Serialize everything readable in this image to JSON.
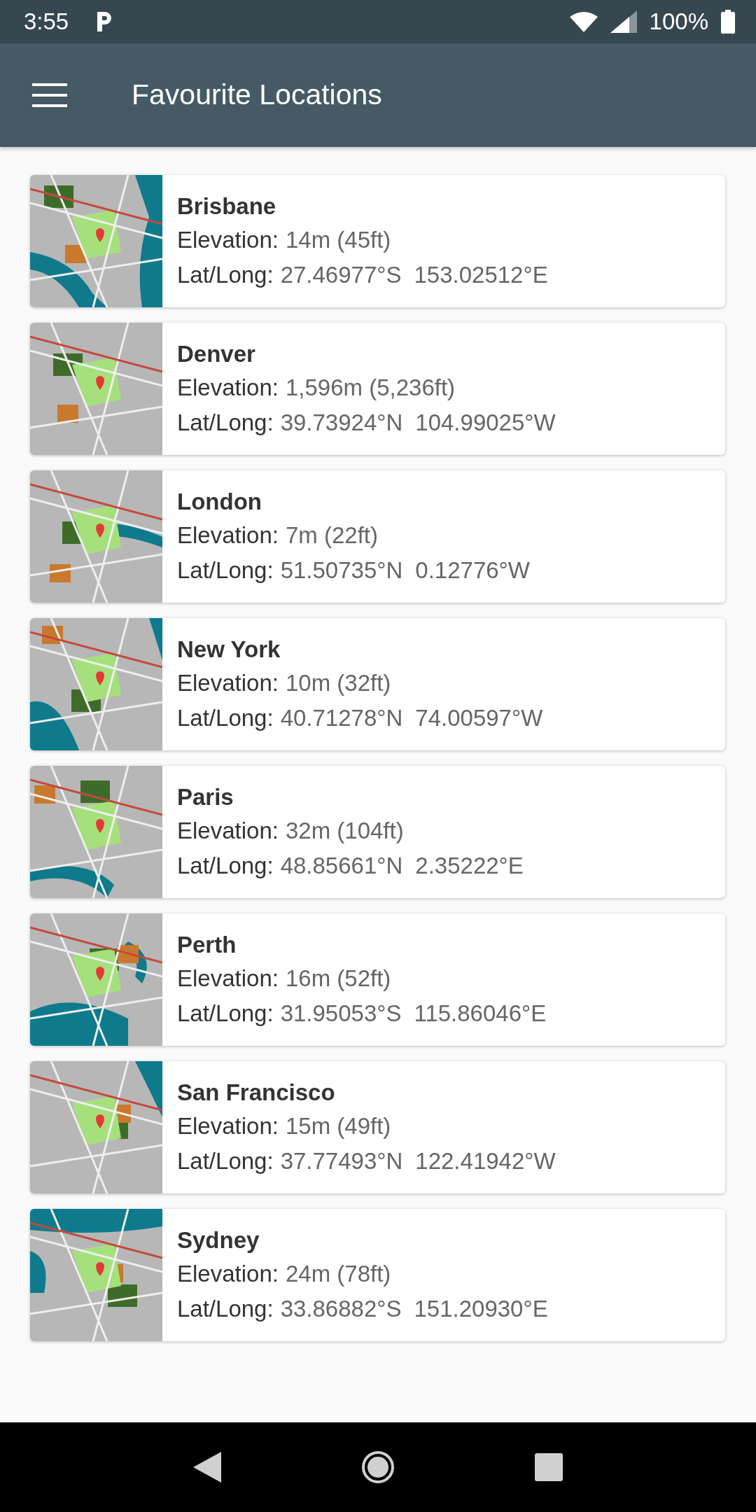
{
  "status_bar": {
    "time": "3:55",
    "battery": "100%"
  },
  "app_bar": {
    "title": "Favourite Locations"
  },
  "locations": [
    {
      "name": "Brisbane",
      "elevation_label": "Elevation:",
      "elevation": "14m (45ft)",
      "latlong_label": "Lat/Long:",
      "lat": "27.46977°S",
      "long": "153.02512°E"
    },
    {
      "name": "Denver",
      "elevation_label": "Elevation:",
      "elevation": "1,596m (5,236ft)",
      "latlong_label": "Lat/Long:",
      "lat": "39.73924°N",
      "long": "104.99025°W"
    },
    {
      "name": "London",
      "elevation_label": "Elevation:",
      "elevation": "7m (22ft)",
      "latlong_label": "Lat/Long:",
      "lat": "51.50735°N",
      "long": "0.12776°W"
    },
    {
      "name": "New York",
      "elevation_label": "Elevation:",
      "elevation": "10m (32ft)",
      "latlong_label": "Lat/Long:",
      "lat": "40.71278°N",
      "long": "74.00597°W"
    },
    {
      "name": "Paris",
      "elevation_label": "Elevation:",
      "elevation": "32m (104ft)",
      "latlong_label": "Lat/Long:",
      "lat": "48.85661°N",
      "long": "2.35222°E"
    },
    {
      "name": "Perth",
      "elevation_label": "Elevation:",
      "elevation": "16m (52ft)",
      "latlong_label": "Lat/Long:",
      "lat": "31.95053°S",
      "long": "115.86046°E"
    },
    {
      "name": "San Francisco",
      "elevation_label": "Elevation:",
      "elevation": "15m (49ft)",
      "latlong_label": "Lat/Long:",
      "lat": "37.77493°N",
      "long": "122.41942°W"
    },
    {
      "name": "Sydney",
      "elevation_label": "Elevation:",
      "elevation": "24m (78ft)",
      "latlong_label": "Lat/Long:",
      "lat": "33.86882°S",
      "long": "151.20930°E"
    }
  ]
}
